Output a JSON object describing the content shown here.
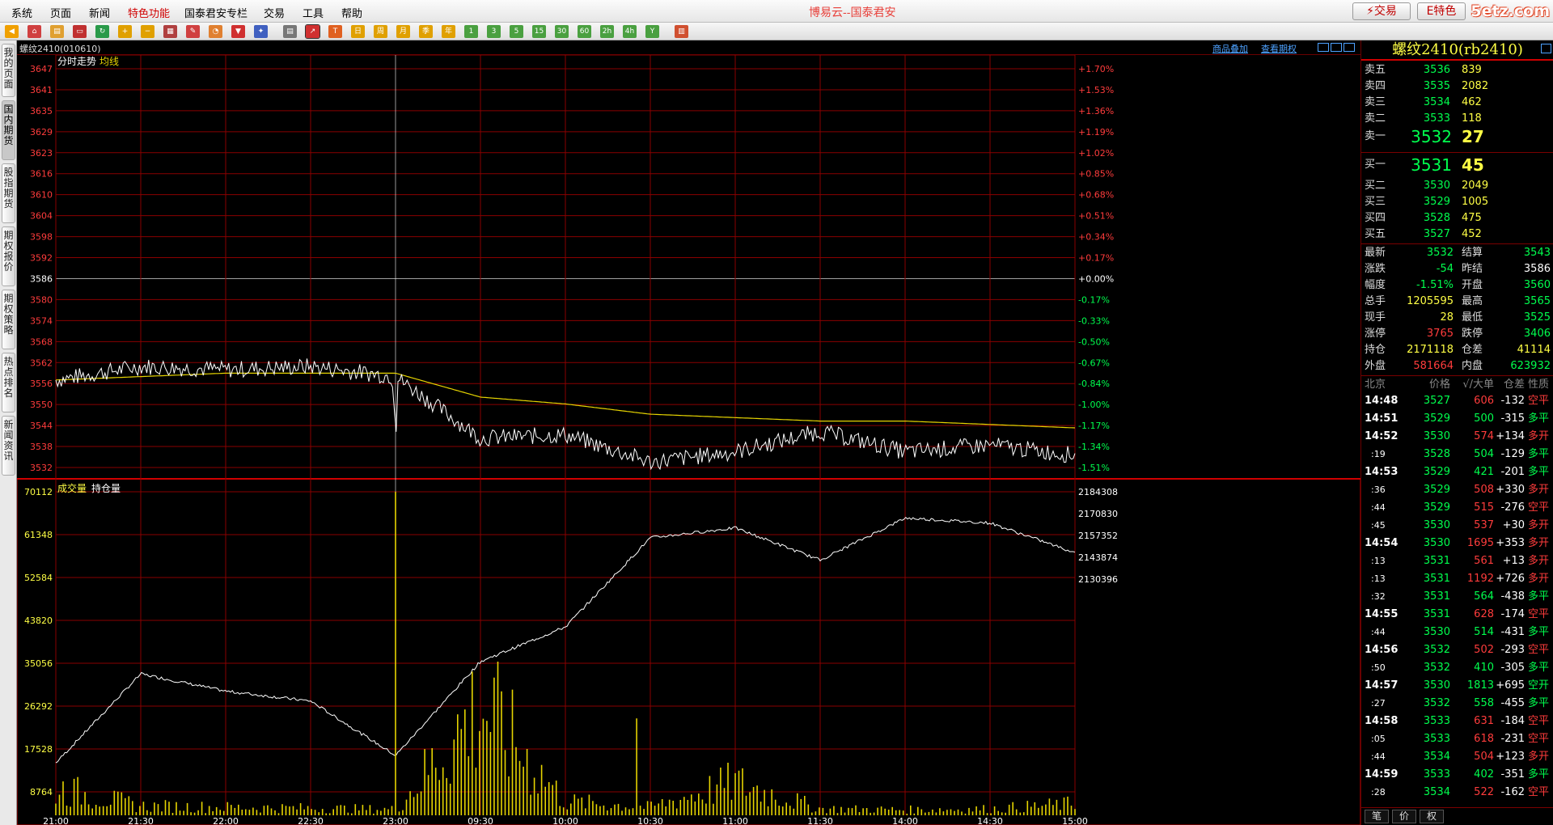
{
  "menu": {
    "items": [
      "系统",
      "页面",
      "新闻",
      "特色功能",
      "国泰君安专栏",
      "交易",
      "工具",
      "帮助"
    ],
    "highlight_index": 3,
    "title": "博易云--国泰君安",
    "trade_label": "⚡交易",
    "feature_label": "E特色",
    "watermark": "5etz.com"
  },
  "left_tabs": [
    "我的页面",
    "国内期货",
    "股指期货",
    "期权报价",
    "期权策略",
    "热点排名",
    "新闻资讯"
  ],
  "left_tabs_active": 1,
  "chart_header": {
    "symbol": "螺纹2410(010610)",
    "link_overlay": "商品叠加",
    "link_options": "查看期权"
  },
  "price_panel": {
    "label_trend": "分时走势",
    "label_avg": "均线",
    "y_left": [
      "3647",
      "3641",
      "3635",
      "3629",
      "3623",
      "3616",
      "3610",
      "3604",
      "3598",
      "3592",
      "3586",
      "3580",
      "3574",
      "3568",
      "3562",
      "3556",
      "3550",
      "3544",
      "3538",
      "3532"
    ],
    "y_right": [
      "+1.70%",
      "+1.53%",
      "+1.36%",
      "+1.19%",
      "+1.02%",
      "+0.85%",
      "+0.68%",
      "+0.51%",
      "+0.34%",
      "+0.17%",
      "+0.00%",
      "-0.17%",
      "-0.33%",
      "-0.50%",
      "-0.67%",
      "-0.84%",
      "-1.00%",
      "-1.17%",
      "-1.34%",
      "-1.51%"
    ]
  },
  "volume_panel": {
    "label_volume": "成交量",
    "label_oi": "持仓量",
    "y_left": [
      "70112",
      "61348",
      "52584",
      "43820",
      "35056",
      "26292",
      "17528",
      "8764"
    ],
    "y_right": [
      "2184308",
      "2170830",
      "2157352",
      "2143874",
      "2130396"
    ]
  },
  "x_labels": [
    "21:00",
    "21:30",
    "22:00",
    "22:30",
    "23:00",
    "09:30",
    "10:00",
    "10:30",
    "11:00",
    "11:30",
    "14:00",
    "14:30",
    "15:00"
  ],
  "chart_data": {
    "type": "line",
    "x": [
      "21:00",
      "21:30",
      "22:00",
      "22:30",
      "23:00",
      "09:30",
      "10:00",
      "10:30",
      "11:00",
      "11:30",
      "14:00",
      "14:30",
      "15:00"
    ],
    "price_ylim": [
      3529,
      3647
    ],
    "series": [
      {
        "name": "分时走势",
        "values": [
          3556,
          3560,
          3559,
          3560,
          3557,
          3539,
          3540,
          3532,
          3535,
          3541,
          3535,
          3537,
          3534
        ]
      },
      {
        "name": "均线",
        "values": [
          3556,
          3557,
          3558,
          3558,
          3558,
          3551,
          3549,
          3546,
          3545,
          3544,
          3544,
          3543,
          3542
        ]
      }
    ],
    "volume_ylim": [
      0,
      70112
    ],
    "volume_values": [
      17528,
      6000,
      5200,
      4600,
      3800,
      70112,
      8764,
      5200,
      21000,
      4200,
      3600,
      4100,
      7400
    ],
    "oi_ylim": [
      2123657,
      2184308
    ],
    "oi_values": [
      2129500,
      2147500,
      2144000,
      2142000,
      2131000,
      2150000,
      2157000,
      2175000,
      2177000,
      2170500,
      2179000,
      2178000,
      2172000
    ]
  },
  "quote": {
    "title": "螺纹2410(rb2410)",
    "asks": [
      {
        "label": "卖五",
        "price": "3536",
        "vol": "839"
      },
      {
        "label": "卖四",
        "price": "3535",
        "vol": "2082"
      },
      {
        "label": "卖三",
        "price": "3534",
        "vol": "462"
      },
      {
        "label": "卖二",
        "price": "3533",
        "vol": "118"
      }
    ],
    "ask1": {
      "label": "卖一",
      "price": "3532",
      "vol": "27"
    },
    "bid1": {
      "label": "买一",
      "price": "3531",
      "vol": "45"
    },
    "bids": [
      {
        "label": "买二",
        "price": "3530",
        "vol": "2049"
      },
      {
        "label": "买三",
        "price": "3529",
        "vol": "1005"
      },
      {
        "label": "买四",
        "price": "3528",
        "vol": "475"
      },
      {
        "label": "买五",
        "price": "3527",
        "vol": "452"
      }
    ],
    "stats": [
      {
        "l1": "最新",
        "v1": "3532",
        "c1": "green",
        "l2": "结算",
        "v2": "3543",
        "c2": "green"
      },
      {
        "l1": "涨跌",
        "v1": "-54",
        "c1": "green",
        "l2": "昨结",
        "v2": "3586",
        "c2": "white"
      },
      {
        "l1": "幅度",
        "v1": "-1.51%",
        "c1": "green",
        "l2": "开盘",
        "v2": "3560",
        "c2": "green"
      },
      {
        "l1": "总手",
        "v1": "1205595",
        "c1": "yellow",
        "l2": "最高",
        "v2": "3565",
        "c2": "green"
      },
      {
        "l1": "现手",
        "v1": "28",
        "c1": "yellow",
        "l2": "最低",
        "v2": "3525",
        "c2": "green"
      },
      {
        "l1": "涨停",
        "v1": "3765",
        "c1": "red",
        "l2": "跌停",
        "v2": "3406",
        "c2": "green"
      },
      {
        "l1": "持仓",
        "v1": "2171118",
        "c1": "yellow",
        "l2": "仓差",
        "v2": "41114",
        "c2": "yellow"
      },
      {
        "l1": "外盘",
        "v1": "581664",
        "c1": "red",
        "l2": "内盘",
        "v2": "623932",
        "c2": "green"
      }
    ],
    "tick_header": {
      "time": "北京",
      "price": "价格",
      "vol": "√/大单",
      "diff": "仓差",
      "nature": "性质"
    },
    "ticks": [
      {
        "time": "14:48",
        "price": "3527",
        "vol": "606",
        "diff": "-132",
        "nature": "空平",
        "vc": "red",
        "dc": "white",
        "nc": "red"
      },
      {
        "time": "14:51",
        "price": "3529",
        "vol": "500",
        "diff": "-315",
        "nature": "多平",
        "vc": "green",
        "dc": "white",
        "nc": "green"
      },
      {
        "time": "14:52",
        "price": "3530",
        "vol": "574",
        "diff": "+134",
        "nature": "多开",
        "vc": "red",
        "dc": "white",
        "nc": "red"
      },
      {
        "time": ":19",
        "price": "3528",
        "vol": "504",
        "diff": "-129",
        "nature": "多平",
        "vc": "green",
        "dc": "white",
        "nc": "green"
      },
      {
        "time": "14:53",
        "price": "3529",
        "vol": "421",
        "diff": "-201",
        "nature": "多平",
        "vc": "green",
        "dc": "white",
        "nc": "green"
      },
      {
        "time": ":36",
        "price": "3529",
        "vol": "508",
        "diff": "+330",
        "nature": "多开",
        "vc": "red",
        "dc": "white",
        "nc": "red"
      },
      {
        "time": ":44",
        "price": "3529",
        "vol": "515",
        "diff": "-276",
        "nature": "空平",
        "vc": "red",
        "dc": "white",
        "nc": "red"
      },
      {
        "time": ":45",
        "price": "3530",
        "vol": "537",
        "diff": "+30",
        "nature": "多开",
        "vc": "red",
        "dc": "white",
        "nc": "red"
      },
      {
        "time": "14:54",
        "price": "3530",
        "vol": "1695",
        "diff": "+353",
        "nature": "多开",
        "vc": "red",
        "dc": "white",
        "nc": "red"
      },
      {
        "time": ":13",
        "price": "3531",
        "vol": "561",
        "diff": "+13",
        "nature": "多开",
        "vc": "red",
        "dc": "white",
        "nc": "red"
      },
      {
        "time": ":13",
        "price": "3531",
        "vol": "1192",
        "diff": "+726",
        "nature": "多开",
        "vc": "red",
        "dc": "white",
        "nc": "red"
      },
      {
        "time": ":32",
        "price": "3531",
        "vol": "564",
        "diff": "-438",
        "nature": "多平",
        "vc": "green",
        "dc": "white",
        "nc": "green"
      },
      {
        "time": "14:55",
        "price": "3531",
        "vol": "628",
        "diff": "-174",
        "nature": "空平",
        "vc": "red",
        "dc": "white",
        "nc": "red"
      },
      {
        "time": ":44",
        "price": "3530",
        "vol": "514",
        "diff": "-431",
        "nature": "多平",
        "vc": "green",
        "dc": "white",
        "nc": "green"
      },
      {
        "time": "14:56",
        "price": "3532",
        "vol": "502",
        "diff": "-293",
        "nature": "空平",
        "vc": "red",
        "dc": "white",
        "nc": "red"
      },
      {
        "time": ":50",
        "price": "3532",
        "vol": "410",
        "diff": "-305",
        "nature": "多平",
        "vc": "green",
        "dc": "white",
        "nc": "green"
      },
      {
        "time": "14:57",
        "price": "3530",
        "vol": "1813",
        "diff": "+695",
        "nature": "空开",
        "vc": "green",
        "dc": "white",
        "nc": "green"
      },
      {
        "time": ":27",
        "price": "3532",
        "vol": "558",
        "diff": "-455",
        "nature": "多平",
        "vc": "green",
        "dc": "white",
        "nc": "green"
      },
      {
        "time": "14:58",
        "price": "3533",
        "vol": "631",
        "diff": "-184",
        "nature": "空平",
        "vc": "red",
        "dc": "white",
        "nc": "red"
      },
      {
        "time": ":05",
        "price": "3533",
        "vol": "618",
        "diff": "-231",
        "nature": "空平",
        "vc": "red",
        "dc": "white",
        "nc": "red"
      },
      {
        "time": ":44",
        "price": "3534",
        "vol": "504",
        "diff": "+123",
        "nature": "多开",
        "vc": "red",
        "dc": "white",
        "nc": "red"
      },
      {
        "time": "14:59",
        "price": "3533",
        "vol": "402",
        "diff": "-351",
        "nature": "多平",
        "vc": "green",
        "dc": "white",
        "nc": "green"
      },
      {
        "time": ":28",
        "price": "3534",
        "vol": "522",
        "diff": "-162",
        "nature": "空平",
        "vc": "red",
        "dc": "white",
        "nc": "red"
      }
    ],
    "bottom_tabs": [
      "笔",
      "价",
      "权"
    ]
  },
  "colors": {
    "grid": "#8a0000",
    "price_line": "#ffffff",
    "avg_line": "#e6d400",
    "volume_bar": "#e6d400",
    "oi_line": "#ffffff",
    "axis_up": "#ff3c3c",
    "axis_down": "#00ff4e",
    "axis_volume": "#ffff45"
  }
}
